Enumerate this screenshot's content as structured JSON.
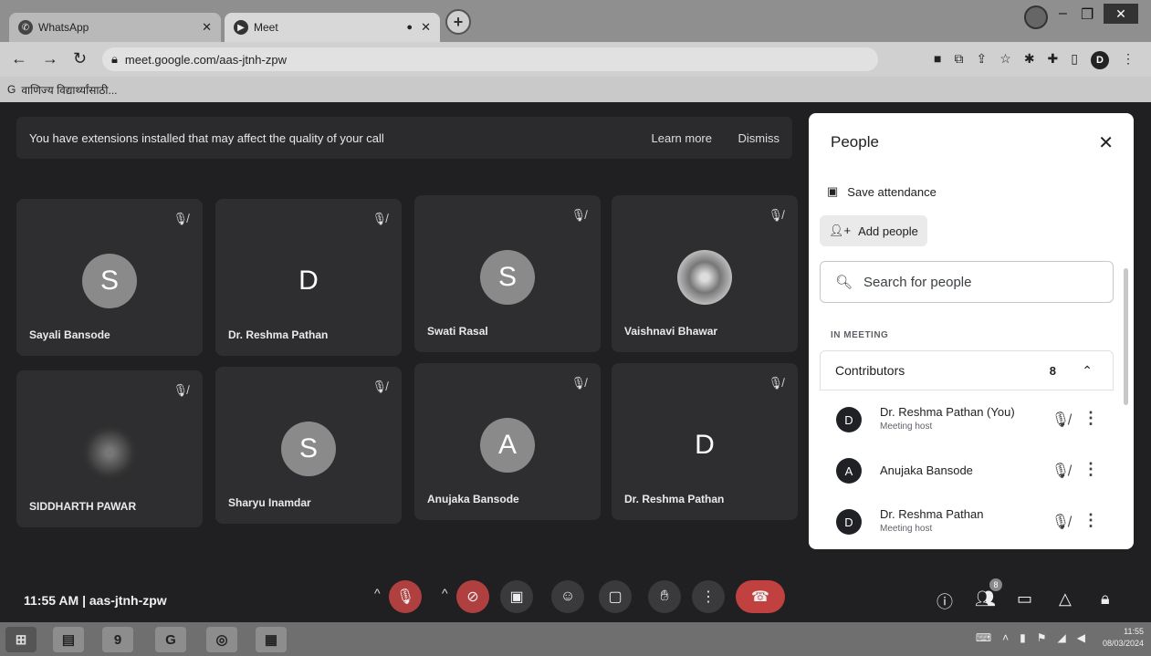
{
  "browser": {
    "tabs": [
      {
        "title": "WhatsApp",
        "icon": "whatsapp-icon"
      },
      {
        "title": "Meet",
        "icon": "meet-icon"
      }
    ],
    "url": "meet.google.com/aas-jtnh-zpw",
    "bookmark": "वाणिज्य विद्यार्थ्यांसाठी..."
  },
  "banner": {
    "message": "You have extensions installed that may affect the quality of your call",
    "learn_more": "Learn more",
    "dismiss": "Dismiss"
  },
  "tiles": [
    {
      "initial": "S",
      "name": "Sayali Bansode"
    },
    {
      "initial": "D",
      "name": "Dr. Reshma Pathan"
    },
    {
      "initial": "S",
      "name": "Swati Rasal"
    },
    {
      "initial": "",
      "name": "Vaishnavi Bhawar"
    },
    {
      "initial": "",
      "name": "SIDDHARTH PAWAR"
    },
    {
      "initial": "S",
      "name": "Sharyu Inamdar"
    },
    {
      "initial": "A",
      "name": "Anujaka Bansode"
    },
    {
      "initial": "D",
      "name": "Dr. Reshma Pathan"
    }
  ],
  "footer": {
    "time": "11:55 AM",
    "separator": "|",
    "meeting_code": "aas-jtnh-zpw",
    "people_badge": "8"
  },
  "people_panel": {
    "title": "People",
    "save_attendance": "Save attendance",
    "add_people": "Add people",
    "search_placeholder": "Search for people",
    "section": "IN MEETING",
    "contributors_label": "Contributors",
    "contributors_count": "8",
    "people": [
      {
        "initial": "D",
        "name": "Dr. Reshma Pathan (You)",
        "role": "Meeting host"
      },
      {
        "initial": "A",
        "name": "Anujaka Bansode",
        "role": ""
      },
      {
        "initial": "D",
        "name": "Dr. Reshma Pathan",
        "role": "Meeting host"
      }
    ]
  },
  "taskbar": {
    "clock_time": "11:55",
    "clock_date": "08/03/2024"
  }
}
